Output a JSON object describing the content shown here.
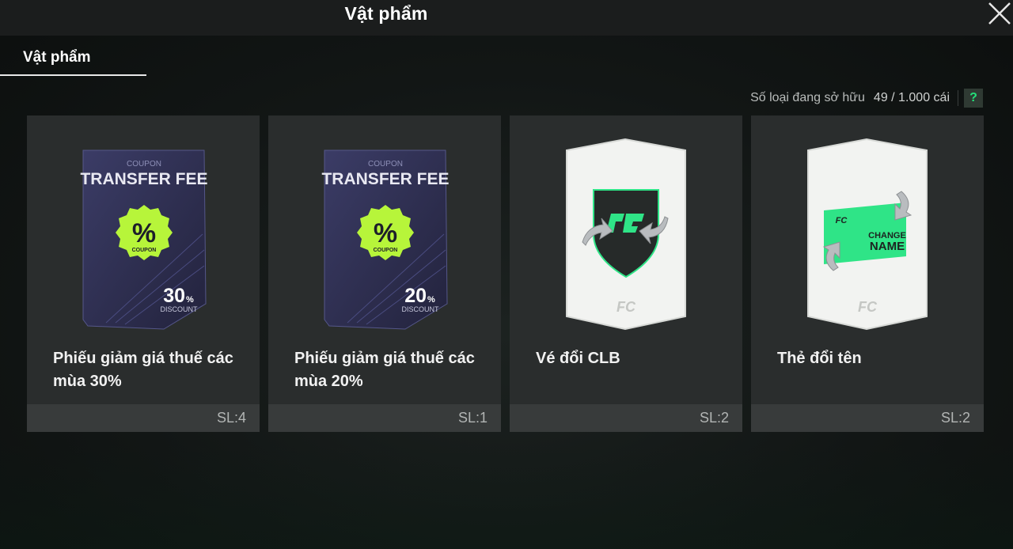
{
  "header": {
    "title": "Vật phẩm"
  },
  "tabs": [
    {
      "label": "Vật phẩm",
      "active": true
    }
  ],
  "owned": {
    "label": "Số loại đang sở hữu",
    "count": "49 / 1.000 cái",
    "help": "?"
  },
  "items": [
    {
      "name": "Phiếu giảm giá thuế các mùa 30%",
      "qty": "SL:4",
      "art": {
        "coupon_label": "COUPON",
        "title": "TRANSFER FEE",
        "badge_symbol": "%",
        "badge_label": "COUPON",
        "percent": "30",
        "percent_unit": "%",
        "discount_label": "DISCOUNT"
      }
    },
    {
      "name": "Phiếu giảm giá thuế các mùa 20%",
      "qty": "SL:1",
      "art": {
        "coupon_label": "COUPON",
        "title": "TRANSFER FEE",
        "badge_symbol": "%",
        "badge_label": "COUPON",
        "percent": "20",
        "percent_unit": "%",
        "discount_label": "DISCOUNT"
      }
    },
    {
      "name": "Vé đổi CLB",
      "qty": "SL:2",
      "art": {
        "logo": "FC"
      }
    },
    {
      "name": "Thẻ đổi tên",
      "qty": "SL:2",
      "art": {
        "logo": "FC",
        "line1": "CHANGE",
        "line2": "NAME"
      }
    }
  ],
  "colors": {
    "accent": "#24e07a",
    "coupon_dark": "#2b2c4a",
    "badge": "#b7f53a",
    "card_bg": "#2a2d2d"
  }
}
